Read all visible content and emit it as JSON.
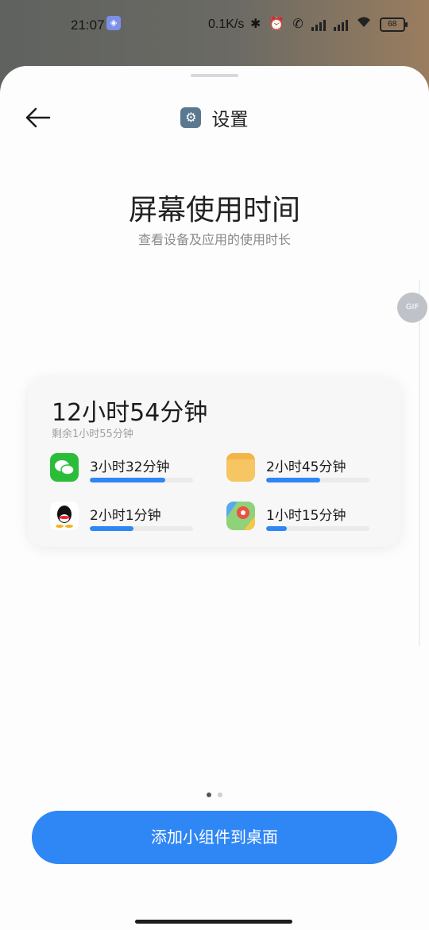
{
  "status_bar": {
    "time": "21:07",
    "net_speed": "0.1K/s",
    "battery": "68",
    "icons": [
      "app-notify-icon",
      "bluetooth-icon",
      "alarm-icon",
      "call-icon",
      "signal-icon",
      "signal-icon",
      "wifi-icon",
      "battery-icon"
    ]
  },
  "header": {
    "title": "设置",
    "icon": "gear-icon"
  },
  "hero": {
    "title": "屏幕使用时间",
    "subtitle": "查看设备及应用的使用时长"
  },
  "badge": {
    "label": "GIF"
  },
  "widget": {
    "total": "12小时54分钟",
    "remaining": "剩余1小时55分钟",
    "apps": [
      {
        "icon": "wechat-icon",
        "duration": "3小时32分钟",
        "share": 0.73
      },
      {
        "icon": "notes-icon",
        "duration": "2小时45分钟",
        "share": 0.52
      },
      {
        "icon": "qq-icon",
        "duration": "2小时1分钟",
        "share": 0.42
      },
      {
        "icon": "baidu-map-icon",
        "duration": "1小时15分钟",
        "share": 0.2
      }
    ]
  },
  "pager": {
    "count": 2,
    "active": 0
  },
  "add_button": {
    "label": "添加小组件到桌面"
  },
  "colors": {
    "accent": "#2f86f5",
    "sheet": "#fdfdfd"
  }
}
